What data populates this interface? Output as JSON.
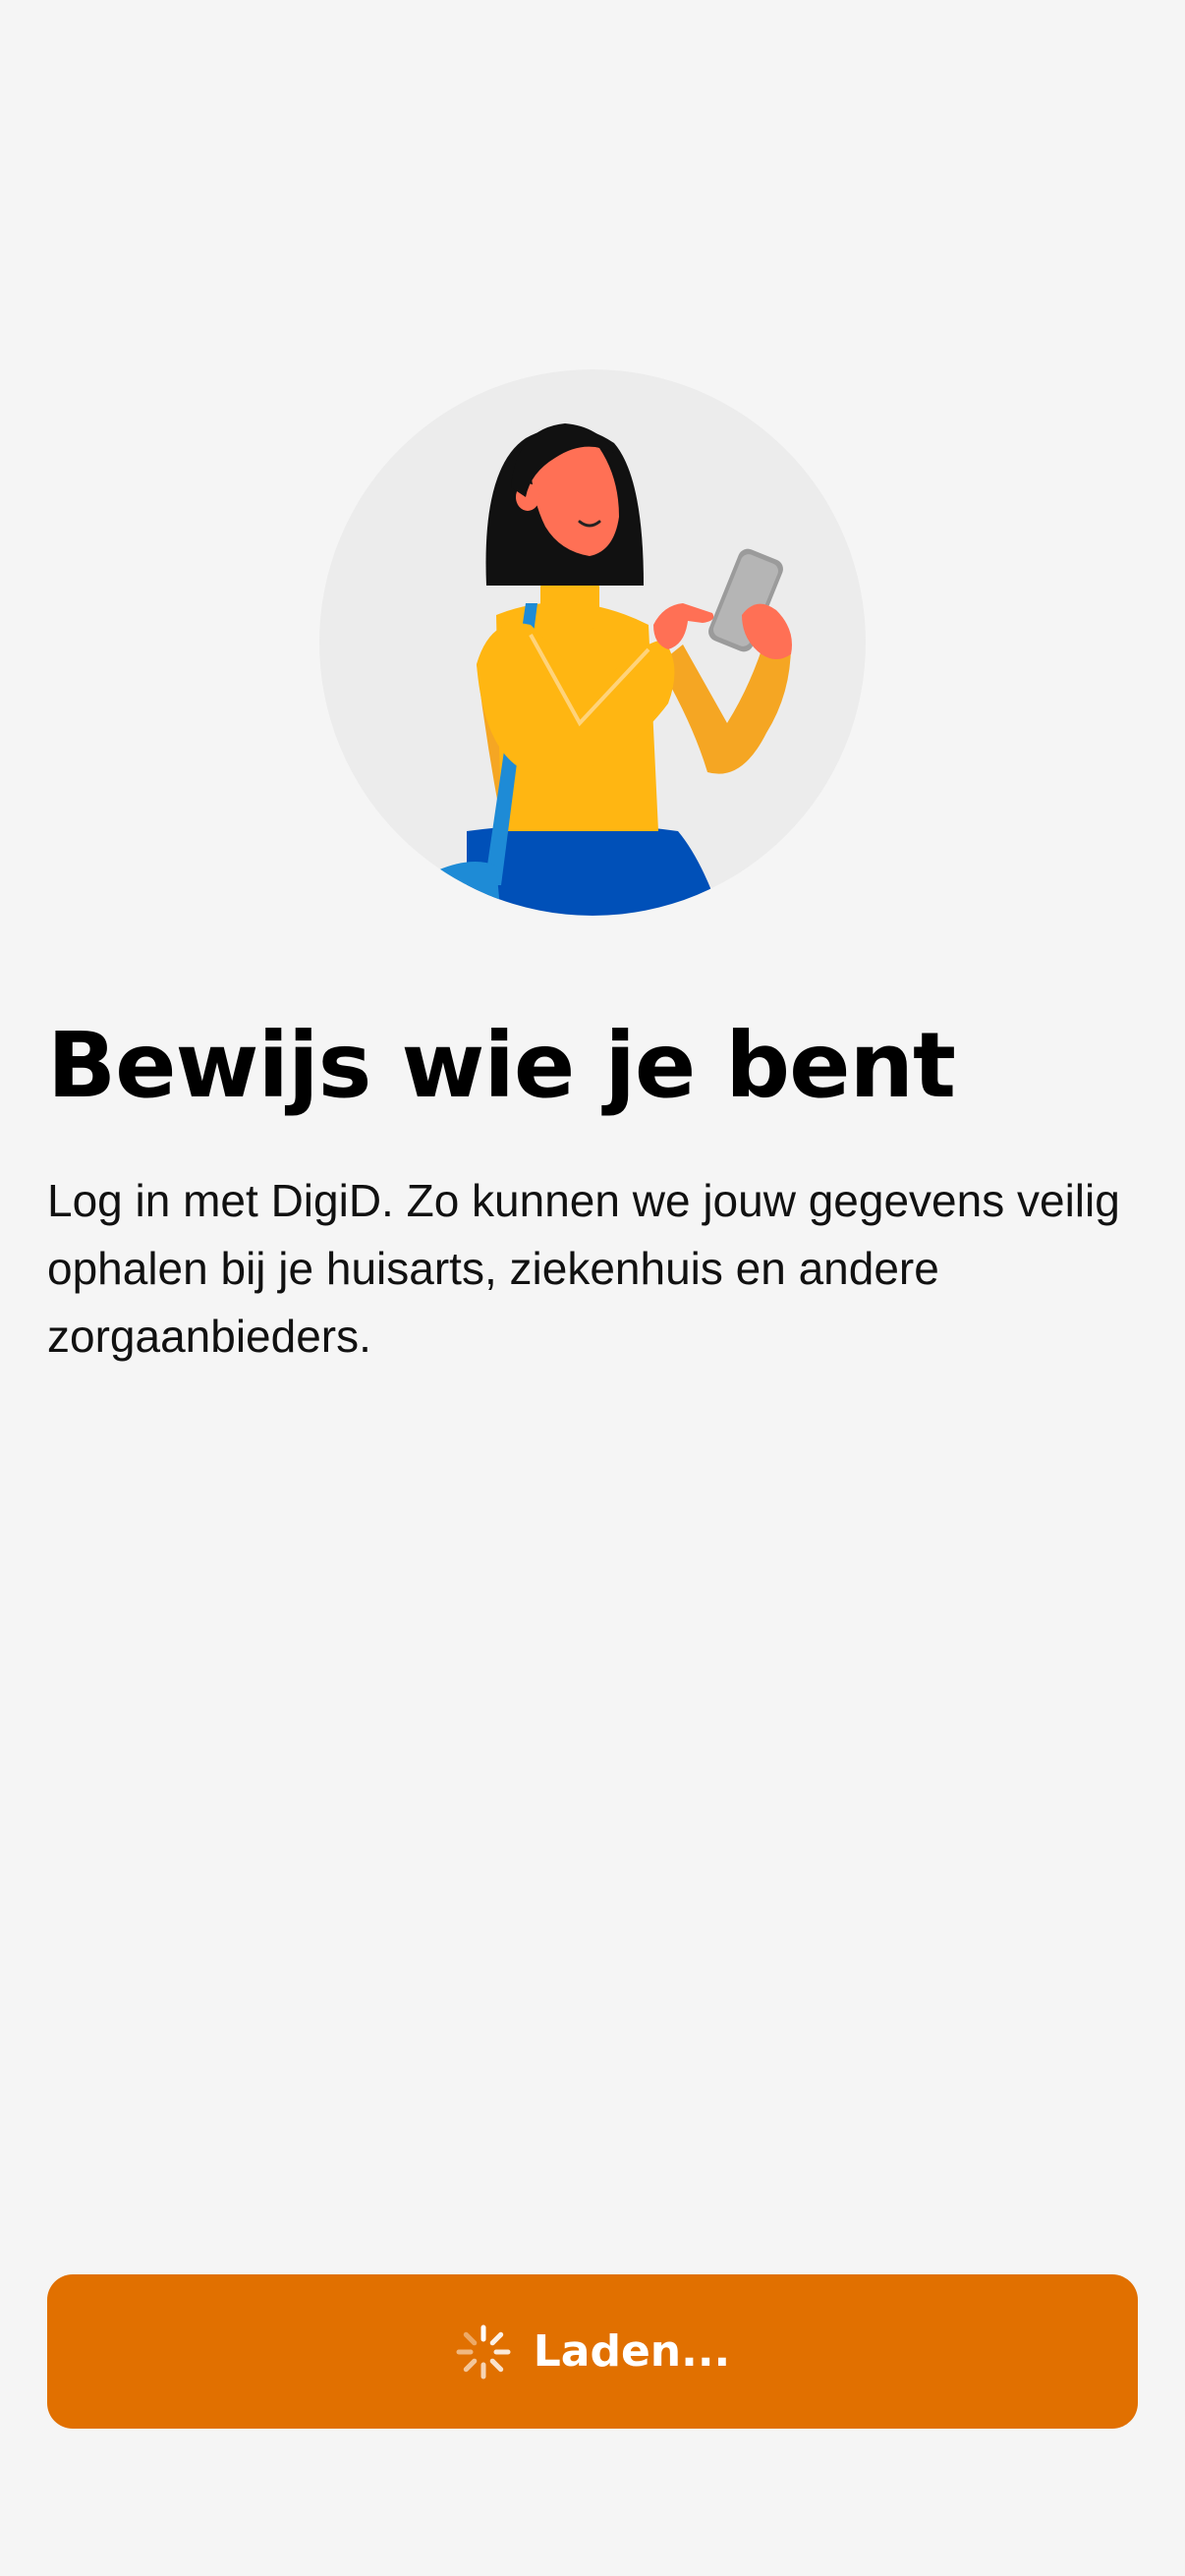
{
  "illustration": {
    "icon": "person-with-phone-illustration"
  },
  "onboarding": {
    "title": "Bewijs wie je bent",
    "description": "Log in met DigiD. Zo kunnen we jouw gegevens veilig ophalen bij je huisarts, ziekenhuis en andere zorgaanbieders."
  },
  "button": {
    "label": "Laden...",
    "icon": "loading-spinner-icon",
    "color": "#e17000"
  }
}
